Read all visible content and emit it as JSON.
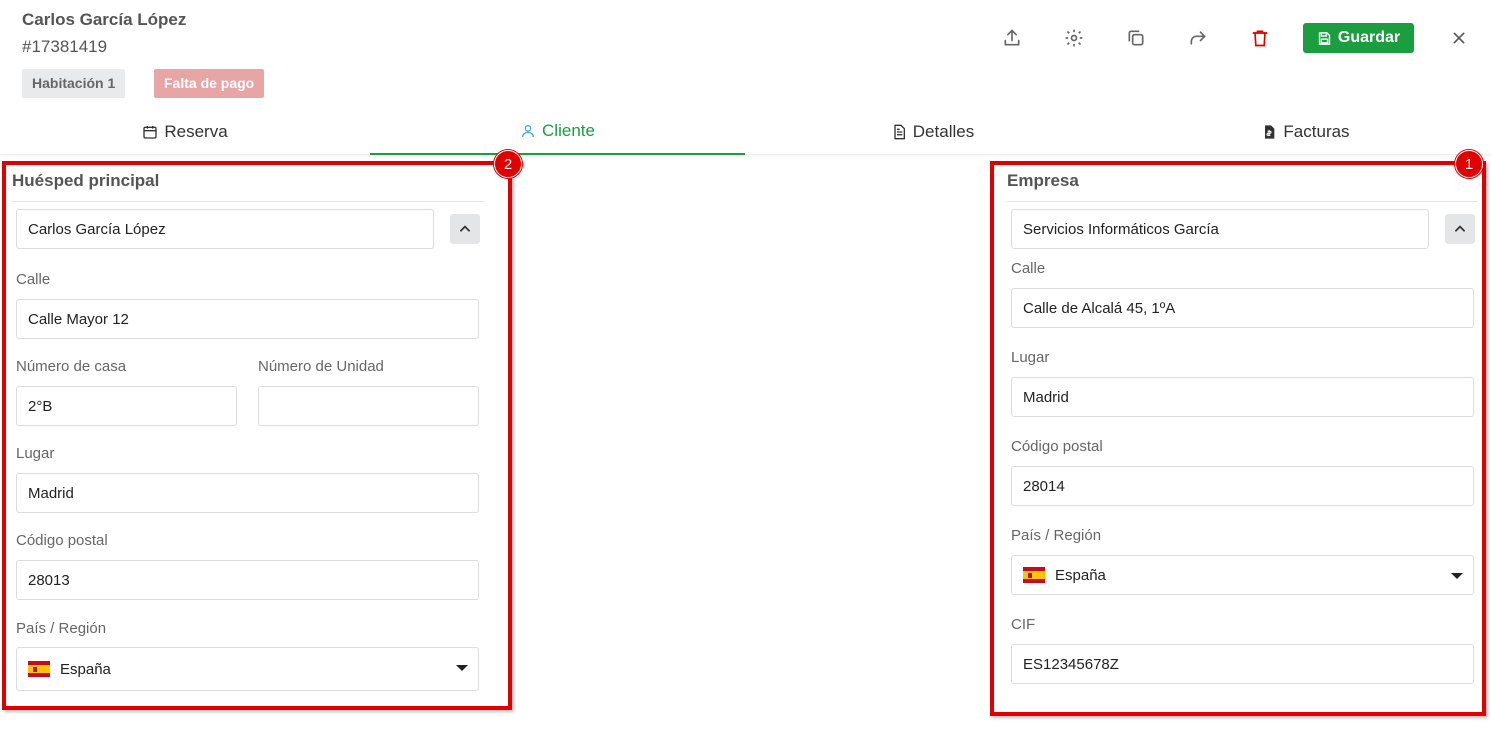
{
  "header": {
    "guest_name": "Carlos García López",
    "booking_id": "#17381419",
    "room_badge": "Habitación 1",
    "status_badge": "Falta de pago",
    "save_label": "Guardar"
  },
  "toolbar": {
    "icons": [
      "upload-icon",
      "gear-icon",
      "copy-icon",
      "share-icon",
      "trash-icon",
      "close-icon"
    ]
  },
  "tabs": [
    {
      "label": "Reserva",
      "icon": "calendar-icon"
    },
    {
      "label": "Cliente",
      "icon": "user-icon",
      "active": true
    },
    {
      "label": "Detalles",
      "icon": "document-icon"
    },
    {
      "label": "Facturas",
      "icon": "invoice-icon"
    }
  ],
  "markers": {
    "left": "2",
    "right": "1"
  },
  "guest": {
    "title": "Huésped principal",
    "name": "Carlos García López",
    "street_label": "Calle",
    "street": "Calle Mayor 12",
    "house_number_label": "Número de casa",
    "house_number": "2°B",
    "unit_number_label": "Número de Unidad",
    "unit_number": "",
    "city_label": "Lugar",
    "city": "Madrid",
    "postal_label": "Código postal",
    "postal": "28013",
    "country_label": "País / Región",
    "country": "España"
  },
  "company": {
    "title": "Empresa",
    "name": "Servicios Informáticos García",
    "street_label": "Calle",
    "street": "Calle de Alcalá 45, 1ºA",
    "city_label": "Lugar",
    "city": "Madrid",
    "postal_label": "Código postal",
    "postal": "28014",
    "country_label": "País / Región",
    "country": "España",
    "cif_label": "CIF",
    "cif": "ES12345678Z"
  },
  "colors": {
    "accent": "#1a9e3f",
    "danger": "#e00000",
    "status_badge": "#e8a5a5"
  }
}
